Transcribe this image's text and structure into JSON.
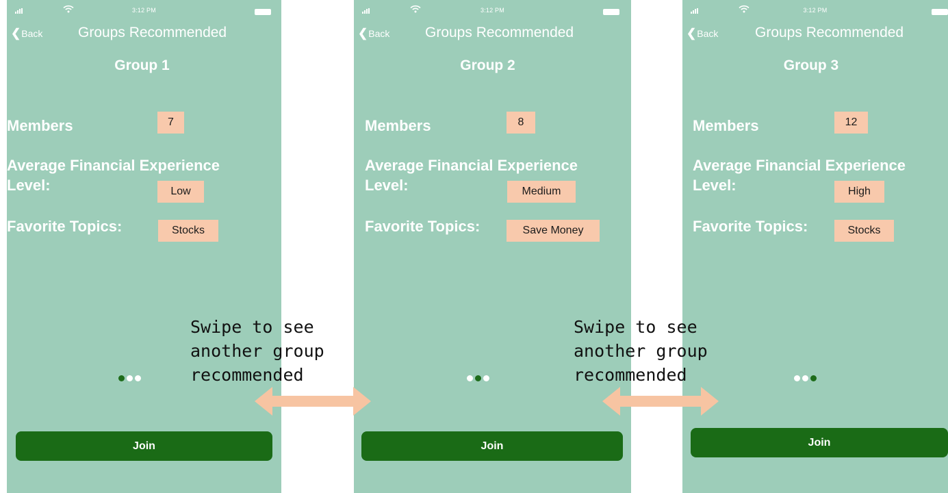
{
  "status": {
    "time": "3:12 PM"
  },
  "nav": {
    "back_label": "Back",
    "title": "Groups Recommended"
  },
  "labels": {
    "members": "Members",
    "experience_line1": "Average Financial Experience",
    "experience_line2": "Level:",
    "topics": "Favorite Topics:"
  },
  "screens": [
    {
      "group_title": "Group 1",
      "members": "7",
      "experience": "Low",
      "topic": "Stocks",
      "active_dot": 1,
      "join_label": "Join"
    },
    {
      "group_title": "Group 2",
      "members": "8",
      "experience": "Medium",
      "topic": "Save Money",
      "active_dot": 2,
      "join_label": "Join"
    },
    {
      "group_title": "Group 3",
      "members": "12",
      "experience": "High",
      "topic": "Stocks",
      "active_dot": 3,
      "join_label": "Join"
    }
  ],
  "annotations": [
    {
      "text": "Swipe to see another group recommended"
    },
    {
      "text": "Swipe to see another group recommended"
    }
  ],
  "colors": {
    "screen_bg": "#9dcdb9",
    "chip_bg": "#f8c9ac",
    "join_bg": "#1a6b16",
    "dot_active": "#1e6c1a",
    "arrow": "#f7c4a2"
  },
  "icons": [
    "signal-icon",
    "wifi-icon",
    "battery-icon",
    "back-chevron-icon",
    "double-arrow-icon"
  ]
}
